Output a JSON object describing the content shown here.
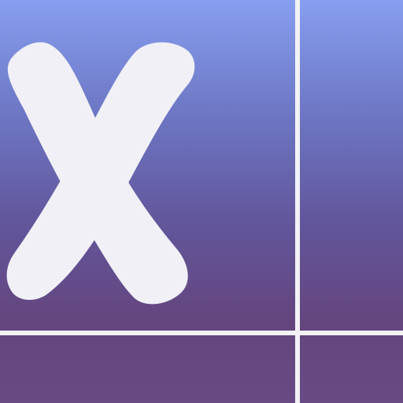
{
  "icon": {
    "symbol": "x-mark",
    "colors": {
      "gradient_top": "#879ef0",
      "gradient_middle": "#62569c",
      "gradient_bottom": "#6a4a84",
      "mark": "#f0f0f6",
      "grid_line": "#f2f2f6"
    }
  }
}
